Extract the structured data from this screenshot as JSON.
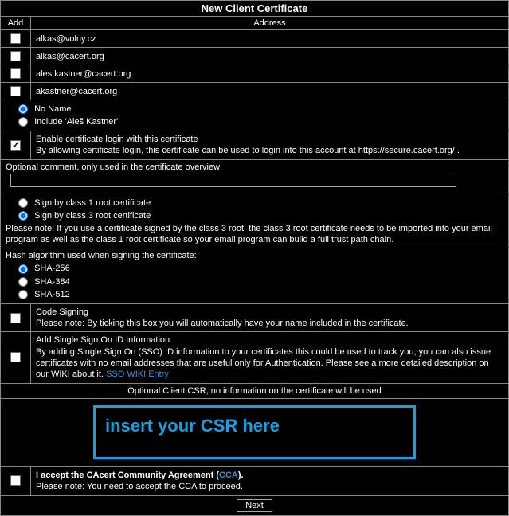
{
  "title": "New Client Certificate",
  "headers": {
    "add": "Add",
    "address": "Address"
  },
  "emails": [
    "alkas@volny.cz",
    "alkas@cacert.org",
    "ales.kastner@cacert.org",
    "akastner@cacert.org"
  ],
  "nameOptions": {
    "noName": "No Name",
    "include": "Include 'Aleš Kastner'"
  },
  "enableLogin": {
    "line1": "Enable certificate login with this certificate",
    "line2": "By allowing certificate login, this certificate can be used to login into this account at https://secure.cacert.org/ ."
  },
  "optionalComment": "Optional comment, only used in the certificate overview",
  "rootSign": {
    "class1": "Sign by class 1 root certificate",
    "class3": "Sign by class 3 root certificate",
    "note": "Please note: If you use a certificate signed by the class 3 root, the class 3 root certificate needs to be imported into your email program as well as the class 1 root certificate so your email program can build a full trust path chain."
  },
  "hash": {
    "label": "Hash algorithm used when signing the certificate:",
    "sha256": "SHA-256",
    "sha384": "SHA-384",
    "sha512": "SHA-512"
  },
  "codeSigning": {
    "title": "Code Signing",
    "note": "Please note: By ticking this box you will automatically have your name included in the certificate."
  },
  "sso": {
    "title": "Add Single Sign On ID Information",
    "body": "By adding Single Sign On (SSO) ID information to your certificates this could be used to track you, you can also issue certificates with no email addresses that are useful only for Authentication. Please see a more detailed description on our WIKI about it. ",
    "link": "SSO WIKI Entry"
  },
  "csr": {
    "header": "Optional Client CSR, no information on the certificate will be used",
    "placeholder": "insert your CSR here"
  },
  "accept": {
    "prefix": "I accept the CAcert Community Agreement (",
    "link": "CCA",
    "suffix": ").",
    "note": "Please note: You need to accept the CCA to proceed."
  },
  "next": "Next"
}
